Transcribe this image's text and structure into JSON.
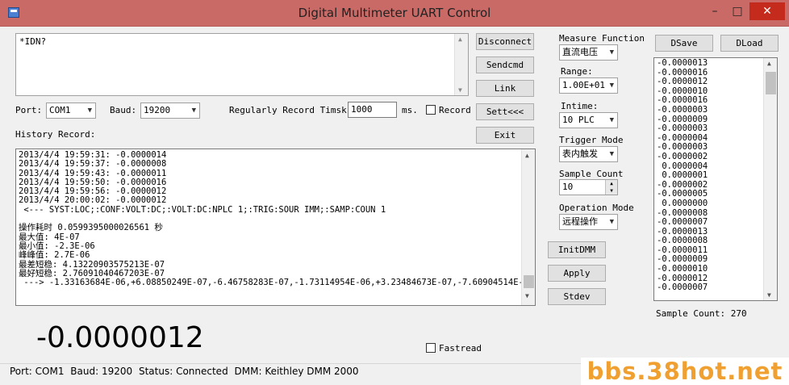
{
  "window": {
    "title": "Digital Multimeter UART Control",
    "min_label": "–",
    "max_label": "□",
    "close_label": "✕"
  },
  "command": {
    "text": "*IDN?"
  },
  "buttons": {
    "disconnect": "Disconnect",
    "sendcmd": "Sendcmd",
    "link": "Link",
    "sett": "Sett<<<",
    "exit": "Exit",
    "initdmm": "InitDMM",
    "apply": "Apply",
    "stdev": "Stdev",
    "dsave": "DSave",
    "dload": "DLoad"
  },
  "port": {
    "label": "Port:",
    "value": "COM1"
  },
  "baud": {
    "label": "Baud:",
    "value": "19200"
  },
  "record": {
    "label": "Regularly Record Timsk:",
    "value": "1000",
    "unit": "ms.",
    "checkbox_label": "Record"
  },
  "history": {
    "label": "History Record:",
    "lines": [
      "2013/4/4 19:59:31: -0.0000014",
      "2013/4/4 19:59:37: -0.0000008",
      "2013/4/4 19:59:43: -0.0000011",
      "2013/4/4 19:59:50: -0.0000016",
      "2013/4/4 19:59:56: -0.0000012",
      "2013/4/4 20:00:02: -0.0000012",
      " <--- SYST:LOC;:CONF:VOLT:DC;:VOLT:DC:NPLC 1;:TRIG:SOUR IMM;:SAMP:COUN 1",
      "",
      "操作耗时 0.0599395000026561 秒",
      "最大值: 4E-07",
      "最小值: -2.3E-06",
      "峰峰值: 2.7E-06",
      "最差短稳: 4.13220903575213E-07",
      "最好短稳: 2.76091040467203E-07",
      " ---> -1.33163684E-06,+6.08850249E-07,-6.46758283E-07,-1.73114954E-06,+3.23484673E-07,-7.60904514E-"
    ]
  },
  "measure_function": {
    "label": "Measure Function",
    "value": "直流电压"
  },
  "range": {
    "label": "Range:",
    "value": "1.00E+01"
  },
  "intime": {
    "label": "Intime:",
    "value": "10 PLC"
  },
  "trigger_mode": {
    "label": "Trigger Mode",
    "value": "表内触发"
  },
  "sample_count": {
    "label": "Sample Count",
    "value": "10"
  },
  "operation_mode": {
    "label": "Operation Mode",
    "value": "远程操作"
  },
  "samples": {
    "values": [
      "-0.0000013",
      "-0.0000016",
      "-0.0000012",
      "-0.0000010",
      "-0.0000016",
      "-0.0000003",
      "-0.0000009",
      "-0.0000003",
      "-0.0000004",
      "-0.0000003",
      "-0.0000002",
      " 0.0000004",
      " 0.0000001",
      "-0.0000002",
      "-0.0000005",
      " 0.0000000",
      "-0.0000008",
      "-0.0000007",
      "-0.0000013",
      "-0.0000008",
      "-0.0000011",
      "-0.0000009",
      "-0.0000010",
      "-0.0000012",
      "-0.0000007"
    ],
    "count_label": "Sample Count:",
    "count_value": "270"
  },
  "reading": {
    "value": "-0.0000012"
  },
  "fastread": {
    "label": "Fastread"
  },
  "status": {
    "port": "Port: COM1",
    "baud": "Baud: 19200",
    "status": "Status: Connected",
    "dmm": "DMM: Keithley DMM 2000"
  },
  "watermark": {
    "text": "bbs.38hot.net"
  }
}
